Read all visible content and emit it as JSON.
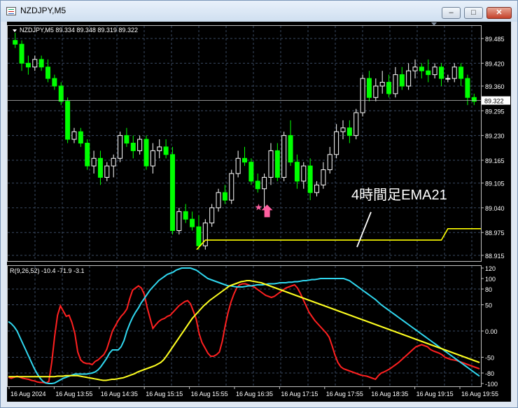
{
  "window": {
    "title": "NZDJPY,M5",
    "minimize_label": "–",
    "maximize_label": "□",
    "close_label": "✕"
  },
  "chart_data": [
    {
      "type": "candlestick",
      "info": "NZDJPY,M5  89.334 89.348 89.319 89.322",
      "ylim": [
        88.9,
        89.52
      ],
      "yticks": [
        "89.485",
        "89.420",
        "89.360",
        "89.295",
        "89.230",
        "89.165",
        "89.105",
        "89.040",
        "88.975",
        "88.915"
      ],
      "last_price": "89.322",
      "colors": {
        "bull": "#ffffff",
        "bear": "#00ff00",
        "ema": "#ffff00",
        "grid": "#3a4a62",
        "axis_text": "#ffffff"
      },
      "candles": [
        [
          89.48,
          89.5,
          89.46,
          89.47
        ],
        [
          89.47,
          89.48,
          89.4,
          89.42
        ],
        [
          89.42,
          89.44,
          89.39,
          89.41
        ],
        [
          89.41,
          89.44,
          89.4,
          89.43
        ],
        [
          89.43,
          89.44,
          89.4,
          89.41
        ],
        [
          89.41,
          89.43,
          89.37,
          89.38
        ],
        [
          89.38,
          89.39,
          89.35,
          89.36
        ],
        [
          89.36,
          89.37,
          89.31,
          89.32
        ],
        [
          89.32,
          89.33,
          89.21,
          89.22
        ],
        [
          89.22,
          89.25,
          89.21,
          89.24
        ],
        [
          89.24,
          89.25,
          89.2,
          89.21
        ],
        [
          89.21,
          89.22,
          89.14,
          89.15
        ],
        [
          89.15,
          89.19,
          89.13,
          89.17
        ],
        [
          89.17,
          89.19,
          89.1,
          89.12
        ],
        [
          89.12,
          89.16,
          89.11,
          89.15
        ],
        [
          89.15,
          89.18,
          89.12,
          89.17
        ],
        [
          89.17,
          89.24,
          89.16,
          89.23
        ],
        [
          89.23,
          89.25,
          89.2,
          89.21
        ],
        [
          89.21,
          89.23,
          89.17,
          89.19
        ],
        [
          89.19,
          89.23,
          89.18,
          89.22
        ],
        [
          89.22,
          89.23,
          89.14,
          89.15
        ],
        [
          89.15,
          89.21,
          89.13,
          89.19
        ],
        [
          89.19,
          89.22,
          89.17,
          89.2
        ],
        [
          89.2,
          89.22,
          89.17,
          89.18
        ],
        [
          89.18,
          89.2,
          88.97,
          88.98
        ],
        [
          88.98,
          89.04,
          88.97,
          89.03
        ],
        [
          89.03,
          89.05,
          89.0,
          89.01
        ],
        [
          89.01,
          89.03,
          88.98,
          88.99
        ],
        [
          88.99,
          89.02,
          88.93,
          88.94
        ],
        [
          88.94,
          89.01,
          88.93,
          89.0
        ],
        [
          89.0,
          89.05,
          88.99,
          89.04
        ],
        [
          89.04,
          89.09,
          89.03,
          89.08
        ],
        [
          89.08,
          89.1,
          89.05,
          89.06
        ],
        [
          89.06,
          89.14,
          89.05,
          89.13
        ],
        [
          89.13,
          89.19,
          89.12,
          89.17
        ],
        [
          89.17,
          89.2,
          89.15,
          89.16
        ],
        [
          89.16,
          89.17,
          89.1,
          89.11
        ],
        [
          89.11,
          89.13,
          89.08,
          89.09
        ],
        [
          89.09,
          89.13,
          89.04,
          89.12
        ],
        [
          89.12,
          89.21,
          89.1,
          89.19
        ],
        [
          89.19,
          89.21,
          89.11,
          89.12
        ],
        [
          89.12,
          89.24,
          89.11,
          89.23
        ],
        [
          89.23,
          89.27,
          89.15,
          89.16
        ],
        [
          89.16,
          89.18,
          89.09,
          89.11
        ],
        [
          89.11,
          89.16,
          89.09,
          89.15
        ],
        [
          89.15,
          89.17,
          89.06,
          89.08
        ],
        [
          89.08,
          89.11,
          89.07,
          89.1
        ],
        [
          89.1,
          89.16,
          89.09,
          89.14
        ],
        [
          89.14,
          89.2,
          89.13,
          89.18
        ],
        [
          89.18,
          89.26,
          89.17,
          89.24
        ],
        [
          89.24,
          89.27,
          89.22,
          89.25
        ],
        [
          89.25,
          89.27,
          89.21,
          89.23
        ],
        [
          89.23,
          89.3,
          89.22,
          89.29
        ],
        [
          89.29,
          89.39,
          89.28,
          89.38
        ],
        [
          89.38,
          89.4,
          89.32,
          89.33
        ],
        [
          89.33,
          89.38,
          89.32,
          89.36
        ],
        [
          89.36,
          89.4,
          89.34,
          89.37
        ],
        [
          89.37,
          89.39,
          89.33,
          89.34
        ],
        [
          89.34,
          89.41,
          89.33,
          89.39
        ],
        [
          89.39,
          89.41,
          89.35,
          89.36
        ],
        [
          89.36,
          89.42,
          89.35,
          89.4
        ],
        [
          89.4,
          89.43,
          89.38,
          89.41
        ],
        [
          89.41,
          89.42,
          89.38,
          89.4
        ],
        [
          89.4,
          89.43,
          89.37,
          89.39
        ],
        [
          89.39,
          89.42,
          89.38,
          89.41
        ],
        [
          89.41,
          89.42,
          89.36,
          89.38
        ],
        [
          89.38,
          89.39,
          89.37,
          89.38
        ],
        [
          89.38,
          89.42,
          89.37,
          89.41
        ],
        [
          89.41,
          89.42,
          89.36,
          89.38
        ],
        [
          89.38,
          89.39,
          89.31,
          89.33
        ],
        [
          89.33,
          89.34,
          89.31,
          89.32
        ]
      ],
      "ema_levels": [
        [
          88.93,
          88.955
        ],
        [
          88.955,
          88.955
        ],
        [
          88.985,
          88.985
        ]
      ],
      "arrow": {
        "candle": 38,
        "price": 89.03
      },
      "annotation": "4時間足EMA21"
    },
    {
      "type": "line",
      "info": "R(9,26,52) -10.4 -71.9 -3.1",
      "ylim": [
        -100,
        120
      ],
      "yticks": [
        "120",
        "100",
        "80",
        "50",
        "0.00",
        "-50",
        "-80",
        "-100"
      ],
      "series": [
        {
          "color": "#ff2020",
          "values": [
            -88,
            -90,
            -88,
            -86,
            -88,
            -90,
            -91,
            -92,
            -94,
            -95,
            -97,
            -98,
            -98,
            -99,
            -96,
            -60,
            -10,
            30,
            48,
            38,
            28,
            30,
            16,
            -5,
            -40,
            -55,
            -60,
            -62,
            -62,
            -64,
            -58,
            -55,
            -50,
            -45,
            -35,
            -18,
            0,
            10,
            20,
            28,
            34,
            42,
            62,
            78,
            82,
            86,
            82,
            70,
            45,
            25,
            5,
            12,
            18,
            22,
            24,
            28,
            30,
            36,
            42,
            48,
            52,
            56,
            58,
            52,
            38,
            22,
            -5,
            -22,
            -32,
            -42,
            -48,
            -48,
            -45,
            -40,
            -20,
            10,
            35,
            55,
            70,
            82,
            88,
            90,
            90,
            88,
            86,
            84,
            80,
            76,
            72,
            68,
            66,
            64,
            66,
            70,
            74,
            78,
            82,
            84,
            86,
            88,
            82,
            72,
            60,
            48,
            36,
            28,
            20,
            14,
            8,
            2,
            -4,
            -12,
            -28,
            -46,
            -60,
            -68,
            -72,
            -74,
            -76,
            -78,
            -80,
            -82,
            -84,
            -85,
            -86,
            -88,
            -90,
            -92,
            -85,
            -80,
            -78,
            -75,
            -72,
            -68,
            -64,
            -60,
            -55,
            -50,
            -45,
            -40,
            -35,
            -30,
            -28,
            -26,
            -28,
            -30,
            -35,
            -38,
            -40,
            -42,
            -45,
            -50,
            -52,
            -54,
            -55,
            -56,
            -58,
            -60,
            -62,
            -64,
            -66,
            -68,
            -70,
            -72
          ]
        },
        {
          "color": "#30d8f0",
          "values": [
            18,
            14,
            8,
            0,
            -12,
            -24,
            -36,
            -48,
            -60,
            -72,
            -82,
            -90,
            -96,
            -99,
            -100,
            -100,
            -99,
            -96,
            -93,
            -90,
            -88,
            -86,
            -84,
            -82,
            -82,
            -82,
            -82,
            -82,
            -81,
            -80,
            -78,
            -74,
            -68,
            -60,
            -52,
            -42,
            -36,
            -36,
            -36,
            -30,
            -18,
            0,
            14,
            26,
            36,
            44,
            54,
            62,
            70,
            78,
            84,
            90,
            96,
            100,
            104,
            108,
            110,
            112,
            116,
            118,
            120,
            120,
            120,
            120,
            118,
            116,
            112,
            108,
            104,
            100,
            98,
            96,
            94,
            92,
            90,
            88,
            86,
            86,
            85,
            84,
            84,
            84,
            85,
            86,
            86,
            87,
            88,
            88,
            88,
            89,
            90,
            90,
            90,
            91,
            92,
            92,
            92,
            93,
            93,
            94,
            94,
            95,
            96,
            96,
            97,
            98,
            98,
            99,
            100,
            100,
            100,
            100,
            100,
            100,
            100,
            100,
            100,
            98,
            96,
            92,
            88,
            84,
            80,
            76,
            72,
            68,
            64,
            60,
            55,
            50,
            46,
            42,
            38,
            34,
            30,
            26,
            22,
            18,
            14,
            10,
            6,
            2,
            -2,
            -6,
            -10,
            -14,
            -18,
            -22,
            -26,
            -30,
            -34,
            -38,
            -42,
            -46,
            -50,
            -54,
            -58,
            -62,
            -66,
            -70,
            -74,
            -78,
            -82,
            -86
          ]
        },
        {
          "color": "#ffff20",
          "values": [
            -87,
            -87,
            -87,
            -87,
            -87,
            -87,
            -87,
            -87,
            -87,
            -87,
            -87,
            -87,
            -87,
            -87,
            -87,
            -87,
            -87,
            -86,
            -86,
            -86,
            -85,
            -85,
            -85,
            -85,
            -85,
            -86,
            -87,
            -88,
            -89,
            -90,
            -91,
            -92,
            -93,
            -94,
            -94,
            -93,
            -92,
            -92,
            -91,
            -90,
            -89,
            -87,
            -85,
            -83,
            -81,
            -78,
            -76,
            -74,
            -72,
            -70,
            -68,
            -66,
            -63,
            -60,
            -55,
            -48,
            -40,
            -32,
            -24,
            -16,
            -8,
            0,
            8,
            16,
            24,
            30,
            36,
            42,
            48,
            53,
            58,
            62,
            66,
            70,
            74,
            78,
            82,
            86,
            88,
            90,
            92,
            94,
            95,
            96,
            96,
            95,
            94,
            93,
            92,
            90,
            88,
            86,
            84,
            82,
            80,
            78,
            76,
            74,
            72,
            70,
            68,
            66,
            64,
            62,
            60,
            58,
            56,
            54,
            52,
            50,
            48,
            46,
            44,
            42,
            40,
            38,
            36,
            34,
            32,
            30,
            28,
            26,
            24,
            22,
            20,
            18,
            16,
            14,
            12,
            10,
            8,
            6,
            4,
            2,
            0,
            -2,
            -4,
            -6,
            -8,
            -10,
            -12,
            -14,
            -16,
            -18,
            -20,
            -22,
            -24,
            -26,
            -28,
            -30,
            -32,
            -34,
            -36,
            -38,
            -40,
            -42,
            -44,
            -46,
            -48,
            -50,
            -52,
            -54,
            -56,
            -58,
            -60
          ]
        }
      ]
    }
  ],
  "x_axis": [
    "16 Aug 2024",
    "16 Aug 13:55",
    "16 Aug 14:35",
    "16 Aug 15:15",
    "16 Aug 15:55",
    "16 Aug 16:35",
    "16 Aug 17:15",
    "16 Aug 17:55",
    "16 Aug 18:35",
    "16 Aug 19:15",
    "16 Aug 19:55"
  ]
}
